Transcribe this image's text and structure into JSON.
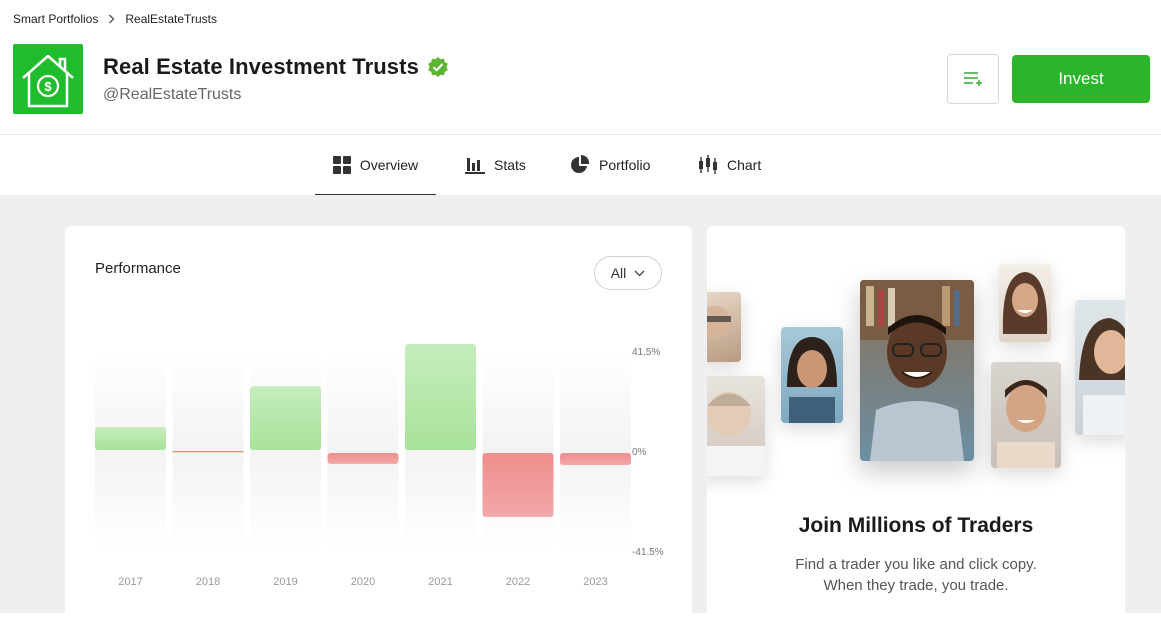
{
  "breadcrumb": {
    "items": [
      "Smart Portfolios",
      "RealEstateTrusts"
    ]
  },
  "header": {
    "title": "Real Estate Investment Trusts",
    "handle": "@RealEstateTrusts",
    "invest_label": "Invest",
    "logo_icon": "house-dollar-icon",
    "verified_icon": "verified-badge-icon",
    "watchlist_icon": "add-to-watchlist-icon"
  },
  "tabs": [
    {
      "label": "Overview",
      "icon": "grid-icon",
      "active": true
    },
    {
      "label": "Stats",
      "icon": "bar-chart-icon",
      "active": false
    },
    {
      "label": "Portfolio",
      "icon": "pie-chart-icon",
      "active": false
    },
    {
      "label": "Chart",
      "icon": "candlestick-icon",
      "active": false
    }
  ],
  "performance": {
    "title": "Performance",
    "range": "All"
  },
  "chart_data": {
    "type": "bar",
    "categories": [
      "2017",
      "2018",
      "2019",
      "2020",
      "2021",
      "2022",
      "2023"
    ],
    "values": [
      9.5,
      -0.5,
      26.5,
      -4.5,
      44,
      -26.5,
      -5
    ],
    "ylim": [
      -41.5,
      41.5
    ],
    "y_ticks": [
      "41.5%",
      "0%",
      "-41.5%"
    ],
    "positive_color": "#a8e29a",
    "negative_color": "#ef8e8e"
  },
  "promo": {
    "title": "Join Millions of Traders",
    "subtitle_line1": "Find a trader you like and click copy.",
    "subtitle_line2": "When they trade, you trade."
  },
  "colors": {
    "brand_green": "#1fbd2c",
    "invest_green": "#2cb52a",
    "verified_green": "#5cb531"
  }
}
